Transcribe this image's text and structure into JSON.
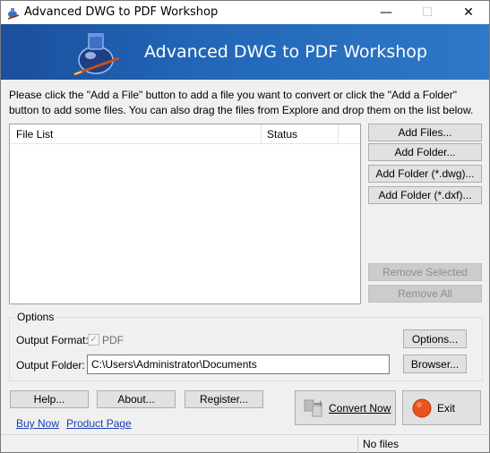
{
  "window": {
    "title": "Advanced DWG to PDF Workshop",
    "minimize": "—",
    "maximize": "☐",
    "close": "✕"
  },
  "banner": {
    "title": "Advanced DWG to PDF Workshop"
  },
  "instruction": "Please click the \"Add a File\" button to add a file you want to convert or click the \"Add a Folder\" button to add some files. You can also drag the files from Explore and drop them on the list below.",
  "file_list": {
    "columns": [
      "File List",
      "Status"
    ],
    "rows": []
  },
  "side_buttons": {
    "add_files": "Add Files...",
    "add_folder": "Add Folder...",
    "add_folder_dwg": "Add Folder (*.dwg)...",
    "add_folder_dxf": "Add Folder (*.dxf)...",
    "remove_selected": "Remove Selected",
    "remove_all": "Remove All"
  },
  "options": {
    "group_label": "Options",
    "output_format_label": "Output Format:",
    "output_format_value": "PDF",
    "output_format_checked": true,
    "options_button": "Options...",
    "output_folder_label": "Output Folder:",
    "output_folder_value": "C:\\Users\\Administrator\\Documents",
    "browse_button": "Browser..."
  },
  "bottom": {
    "help": "Help...",
    "about": "About...",
    "register": "Register...",
    "buy_now": "Buy Now",
    "product_page": "Product Page",
    "convert_now": "Convert Now",
    "exit": "Exit"
  },
  "status_bar": {
    "status_text": "No files"
  },
  "colors": {
    "banner": "#2266b8",
    "link": "#1a3fb5",
    "exit_icon": "#e8531e"
  },
  "icons": {
    "app": "ink-pen-icon",
    "convert": "convert-arrows-icon",
    "exit": "exit-circle-icon",
    "check": "checkmark-icon"
  }
}
